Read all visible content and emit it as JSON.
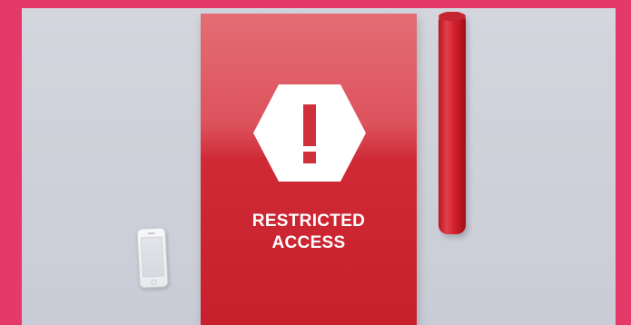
{
  "poster": {
    "line1": "RESTRICTED",
    "line2": "ACCESS",
    "icon": "exclamation-hexagon-icon"
  },
  "colors": {
    "frame": "#e5396a",
    "background": "#d0d2db",
    "poster_red": "#cf2a36",
    "tube_red": "#d5232f",
    "white": "#ffffff"
  },
  "objects": {
    "tube": "rolled-poster-tube",
    "phone": "smartphone-icon"
  }
}
